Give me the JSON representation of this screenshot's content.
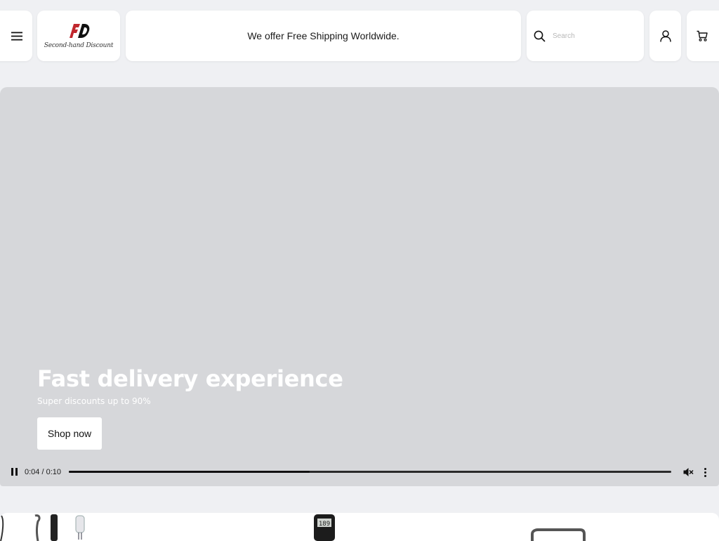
{
  "header": {
    "menu_icon": "menu-icon",
    "logo": {
      "caption": "Second-hand Discount",
      "brand_color": "#c0272d"
    },
    "announcement": "We offer Free Shipping Worldwide.",
    "search": {
      "icon": "search-icon",
      "placeholder": "Search",
      "value": ""
    },
    "account_icon": "user-icon",
    "cart_icon": "cart-icon"
  },
  "hero": {
    "title": "Fast delivery experience",
    "subtitle": "Super discounts up to 90%",
    "cta_label": "Shop now",
    "background_color": "#d6d7da",
    "video": {
      "time_display": "0:04 / 0:10",
      "progress_fraction": 0.4,
      "pause_icon": "pause-icon",
      "mute_icon": "muted-speaker-icon",
      "more_icon": "more-vertical-icon"
    }
  },
  "products": {
    "items": [
      "shower-head-set",
      "digital-meter",
      "storage-rack"
    ]
  }
}
